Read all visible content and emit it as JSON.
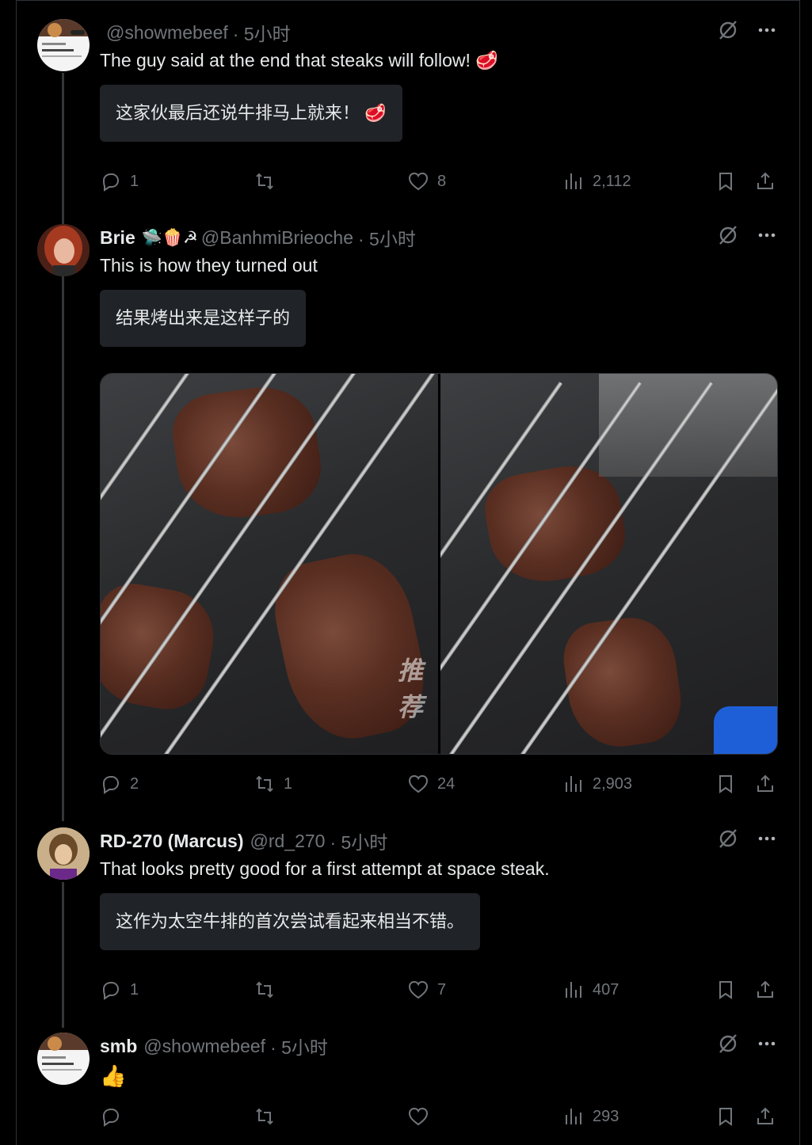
{
  "tweets": [
    {
      "name": "",
      "handle": "@showmebeef",
      "time": "· 5小时",
      "text": "The guy said at the end that steaks will follow! 🥩",
      "translation": "这家伙最后还说牛排马上就来！ 🥩",
      "replies": "1",
      "retweets": "",
      "likes": "8",
      "views": "2,112"
    },
    {
      "name": "Brie",
      "badges": "🛸🍿☭",
      "handle": "@BanhmiBrieoche",
      "time": "· 5小时",
      "text": "This is how they turned out",
      "translation": "结果烤出来是这样子的",
      "watermark": "推荐",
      "replies": "2",
      "retweets": "1",
      "likes": "24",
      "views": "2,903"
    },
    {
      "name": "RD-270 (Marcus)",
      "handle": "@rd_270",
      "time": "· 5小时",
      "text": "That looks pretty good for a first attempt at space steak.",
      "translation": "这作为太空牛排的首次尝试看起来相当不错。",
      "replies": "1",
      "retweets": "",
      "likes": "7",
      "views": "407"
    },
    {
      "name": "smb",
      "handle": "@showmebeef",
      "time": "· 5小时",
      "text": "👍",
      "replies": "",
      "retweets": "",
      "likes": "",
      "views": "293"
    }
  ],
  "icons": {
    "reply": "reply-icon",
    "retweet": "retweet-icon",
    "like": "heart-icon",
    "views": "views-icon",
    "bookmark": "bookmark-icon",
    "share": "share-icon",
    "grok": "slashed-circle-icon",
    "more": "more-icon"
  },
  "colors": {
    "background": "#000000",
    "muted": "#71767b",
    "text": "#e7e9ea",
    "translation_bg": "#202327"
  }
}
